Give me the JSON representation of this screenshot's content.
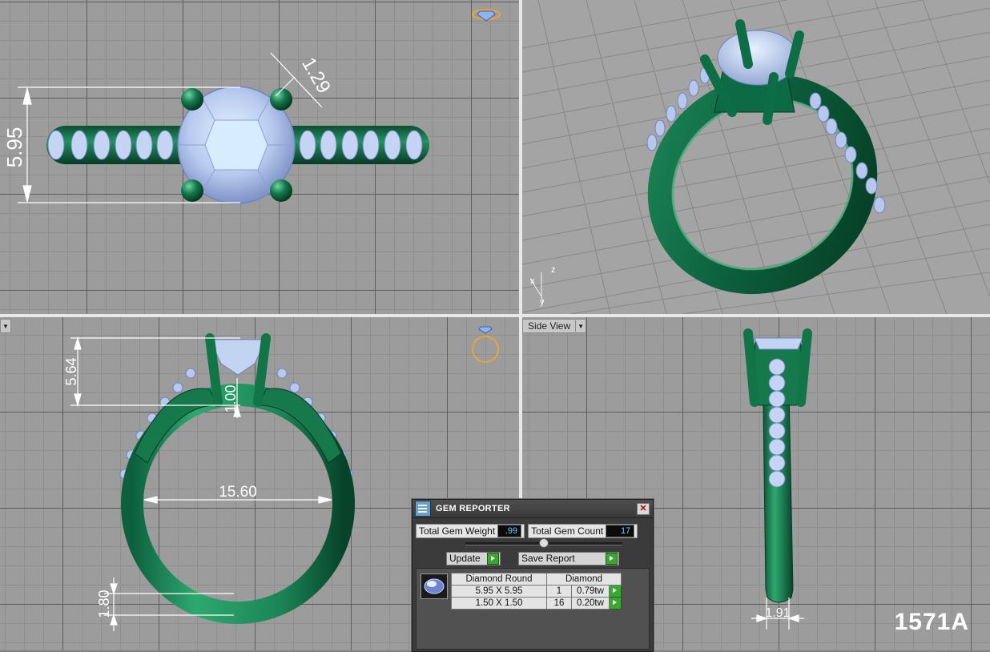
{
  "viewports": {
    "top": {
      "dimensions": {
        "width": "5.95",
        "prong": "1.29"
      }
    },
    "front": {
      "dimensions": {
        "height": "5.64",
        "gap": "1.00",
        "inner_diameter": "15.60",
        "shank": "1.80"
      }
    },
    "side": {
      "menu_label": "Side View",
      "dimensions": {
        "shank_width": "1.91"
      }
    },
    "perspective": {
      "axes": {
        "z": "z",
        "x": "x",
        "y": "y"
      }
    }
  },
  "model_code": "1571A",
  "gem_reporter": {
    "title": "GEM REPORTER",
    "total_weight_label": "Total Gem Weight",
    "total_weight_value": ".99",
    "total_count_label": "Total Gem Count",
    "total_count_value": "17",
    "update_label": "Update",
    "save_label": "Save Report",
    "table": {
      "headers": [
        "Diamond Round",
        "Diamond"
      ],
      "rows": [
        {
          "size": "5.95 X 5.95",
          "count": "1",
          "weight": "0.79tw"
        },
        {
          "size": "1.50 X 1.50",
          "count": "16",
          "weight": "0.20tw"
        }
      ]
    }
  },
  "colors": {
    "metal": "#0e6a45",
    "metal_highlight": "#2fa06e",
    "gem": "#b8ccef",
    "dimension_line": "#ffffff",
    "viewport_grid": "#9c9c9c"
  }
}
